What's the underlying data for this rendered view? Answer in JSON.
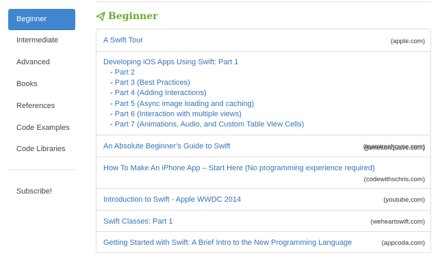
{
  "sidebar": {
    "items": [
      {
        "label": "Beginner",
        "active": true
      },
      {
        "label": "Intermediate"
      },
      {
        "label": "Advanced"
      },
      {
        "label": "Books"
      },
      {
        "label": "References"
      },
      {
        "label": "Code Examples"
      },
      {
        "label": "Code Libraries"
      }
    ],
    "subscribe_label": "Subscribe!"
  },
  "main": {
    "section_title": "Beginner",
    "resources": [
      {
        "title": "A Swift Tour",
        "source": "(apple.com)"
      },
      {
        "title": "Developing iOS Apps Using Swift: Part 1",
        "source": "(jamesonquave.com)",
        "parts": [
          "Part 2",
          "Part 3 (Best Practices)",
          "Part 4 (Adding Interactions)",
          "Part 5 (Async image loading and caching)",
          "Part 6 (Interaction with multiple views)",
          "Part 7 (Animations, Audio, and Custom Table View Cells)"
        ]
      },
      {
        "title": "An Absolute Beginner’s Guide to Swift",
        "source": "(teamtreehouse.com)"
      },
      {
        "title": "How To Make An iPhone App – Start Here (No programming experience required)",
        "source": "(codewithschris.com)"
      },
      {
        "title": "Introduction to Swift - Apple WWDC 2014",
        "source": "(youtube.com)"
      },
      {
        "title": "Swift Classes: Part 1",
        "source": "(weheartswift.com)"
      },
      {
        "title": "Getting Started with Swift: A Brief Intro to the New Programming Language",
        "source": "(appcoda.com)"
      }
    ]
  },
  "colors": {
    "accent": "#3f86cf",
    "link": "#3473b8",
    "heading": "#6eab2b",
    "border": "#dedede"
  }
}
